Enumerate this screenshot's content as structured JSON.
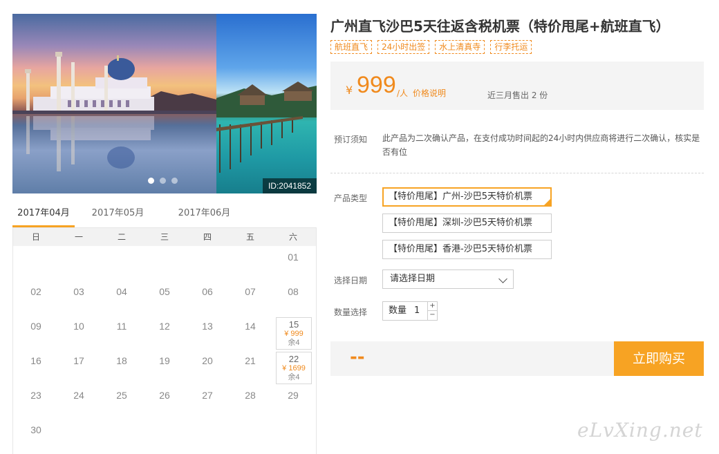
{
  "gallery": {
    "image_id": "ID:2041852",
    "dot_count": 3,
    "active_dot": 0
  },
  "product": {
    "title": "广州直飞沙巴5天往返含税机票（特价甩尾+航班直飞）",
    "tags": [
      "航班直飞",
      "24小时出签",
      "水上清真寺",
      "行李托运"
    ],
    "price": {
      "currency": "¥",
      "value": "999",
      "unit": "/人",
      "link": "价格说明",
      "sold": "近三月售出 2 份"
    },
    "notice": {
      "label": "预订须知",
      "text": "此产品为二次确认产品，在支付成功时间起的24小时内供应商将进行二次确认，核实是否有位"
    },
    "type": {
      "label": "产品类型",
      "options": [
        "【特价甩尾】广州-沙巴5天特价机票",
        "【特价甩尾】深圳-沙巴5天特价机票",
        "【特价甩尾】香港-沙巴5天特价机票"
      ],
      "selected": 0
    },
    "date": {
      "label": "选择日期",
      "placeholder": "请选择日期"
    },
    "quantity": {
      "label": "数量选择",
      "field_label": "数量",
      "value": "1",
      "plus": "+",
      "minus": "−"
    },
    "total": "--",
    "buy": "立即购买"
  },
  "calendar": {
    "months": [
      "2017年04月",
      "2017年05月",
      "2017年06月"
    ],
    "active_month": 0,
    "weekdays": [
      "日",
      "一",
      "二",
      "三",
      "四",
      "五",
      "六"
    ],
    "rows": [
      [
        "",
        "",
        "",
        "",
        "",
        "",
        "01"
      ],
      [
        "02",
        "03",
        "04",
        "05",
        "06",
        "07",
        "08"
      ],
      [
        "09",
        "10",
        "11",
        "12",
        "13",
        "14",
        "15"
      ],
      [
        "16",
        "17",
        "18",
        "19",
        "20",
        "21",
        "22"
      ],
      [
        "23",
        "24",
        "25",
        "26",
        "27",
        "28",
        "29"
      ],
      [
        "30",
        "",
        "",
        "",
        "",
        "",
        ""
      ]
    ],
    "available": {
      "15": {
        "price": "¥ 999",
        "stock": "余4"
      },
      "22": {
        "price": "¥ 1699",
        "stock": "余4"
      }
    }
  },
  "watermark": "eLvXing.net",
  "colors": {
    "accent": "#f7a323",
    "price": "#f08a1d",
    "panel": "#f4f4f4"
  }
}
